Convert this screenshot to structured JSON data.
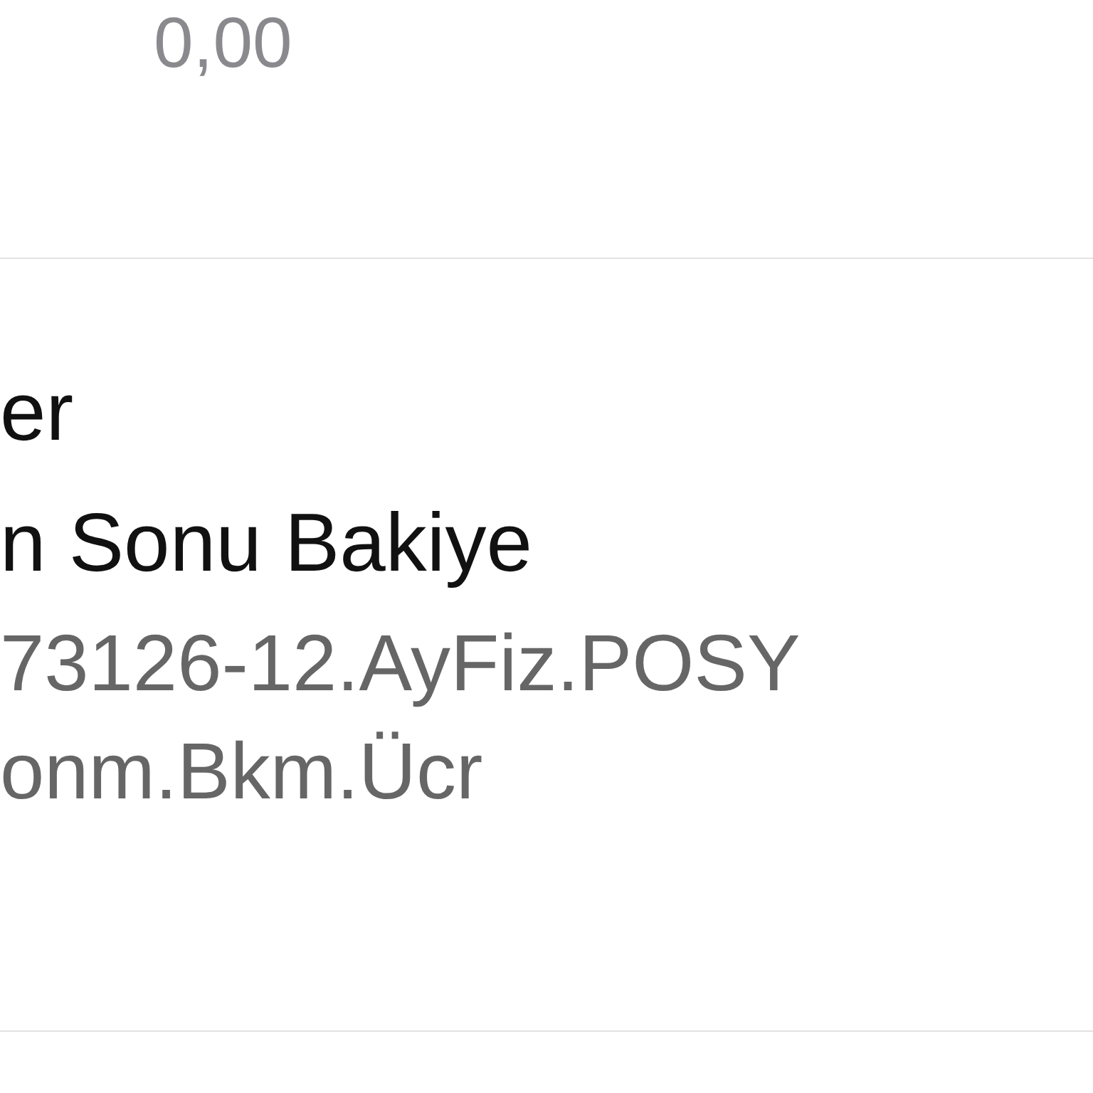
{
  "amount": "0,00",
  "transaction": {
    "title_lines": [
      "er",
      "n Sonu Bakiye"
    ],
    "detail_lines": [
      "73126-12.AyFiz.POSY",
      "onm.Bkm.Ücr"
    ]
  }
}
